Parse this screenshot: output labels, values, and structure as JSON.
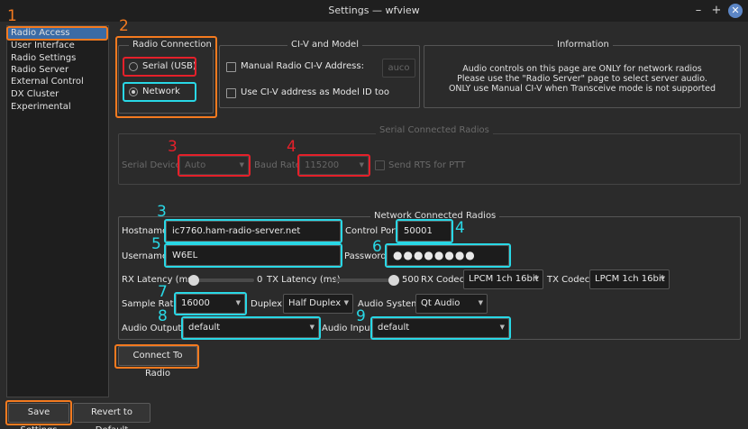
{
  "window": {
    "title": "Settings — wfview",
    "min_icon": "minimize-icon",
    "max_icon": "maximize-icon",
    "close_icon": "close-icon"
  },
  "sidebar": {
    "items": [
      "Radio Access",
      "User Interface",
      "Radio Settings",
      "Radio Server",
      "External Control",
      "DX Cluster",
      "Experimental"
    ],
    "selected": "Radio Access"
  },
  "radio_connection": {
    "title": "Radio Connection",
    "serial_label": "Serial (USB)",
    "network_label": "Network",
    "selected": "Network"
  },
  "civ": {
    "title": "CI-V and Model",
    "manual_label": "Manual Radio CI-V Address:",
    "manual_value": "auco",
    "use_civ_label": "Use CI-V address as Model ID too"
  },
  "information": {
    "title": "Information",
    "lines": [
      "Audio controls on this page are ONLY for network radios",
      "Please use the \"Radio Server\" page to select server audio.",
      "ONLY use Manual CI-V when Transceive mode is not supported"
    ]
  },
  "serial": {
    "title": "Serial Connected Radios",
    "device_label": "Serial Device:",
    "device_value": "Auto",
    "baud_label": "Baud Rate",
    "baud_value": "115200",
    "rts_label": "Send RTS for PTT"
  },
  "network": {
    "title": "Network Connected Radios",
    "hostname_label": "Hostname",
    "hostname_value": "ic7760.ham-radio-server.net",
    "port_label": "Control Port",
    "port_value": "50001",
    "username_label": "Username",
    "username_value": "W6EL",
    "password_label": "Password",
    "password_value": "●●●●●●●●",
    "rx_latency_label": "RX Latency (ms)",
    "rx_latency_value": "0",
    "tx_latency_label": "TX Latency (ms)",
    "tx_latency_value": "500",
    "rx_codec_label": "RX Codec",
    "rx_codec_value": "LPCM 1ch 16bit",
    "tx_codec_label": "TX Codec",
    "tx_codec_value": "LPCM 1ch 16bit",
    "sample_rate_label": "Sample Rate",
    "sample_rate_value": "16000",
    "duplex_label": "Duplex",
    "duplex_value": "Half Duplex",
    "audio_system_label": "Audio System",
    "audio_system_value": "Qt Audio",
    "audio_output_label": "Audio Output",
    "audio_output_value": "default",
    "audio_input_label": "Audio Input",
    "audio_input_value": "default",
    "connect_label": "Connect To Radio"
  },
  "footer": {
    "save_label": "Save Settings",
    "revert_label": "Revert to Default"
  },
  "annotations": [
    "1",
    "2",
    "3",
    "4",
    "3",
    "4",
    "5",
    "6",
    "7",
    "8",
    "9"
  ],
  "annotation_colors": {
    "orange": "#f47a1f",
    "red": "#e5202a",
    "cyan": "#29d8e6"
  }
}
